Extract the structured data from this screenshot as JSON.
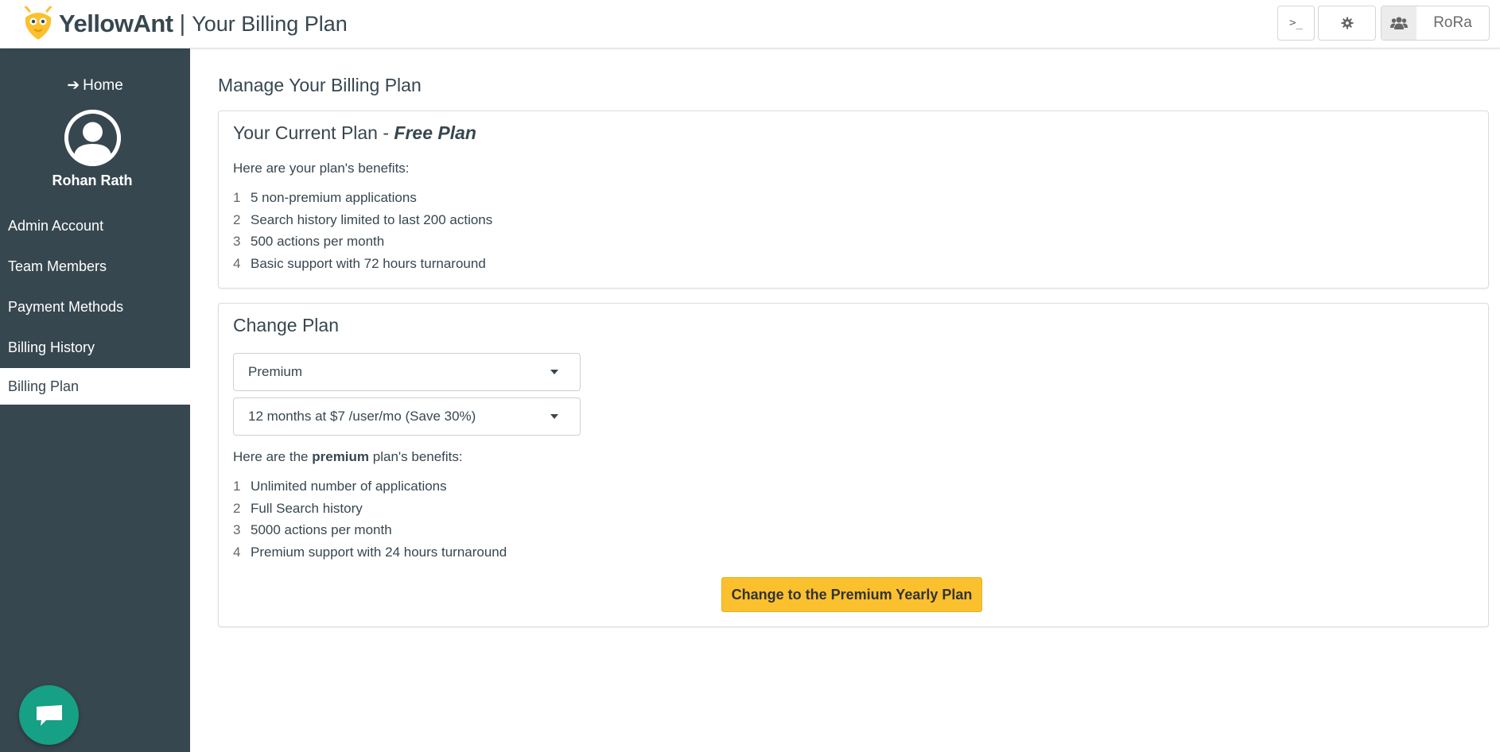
{
  "header": {
    "brand_name": "YellowAnt",
    "separator": "|",
    "page_title": "Your Billing Plan",
    "terminal_label": ">_",
    "user_label": "RoRa"
  },
  "sidebar": {
    "home_label": "Home",
    "user_name": "Rohan Rath",
    "items": [
      {
        "label": "Admin Account"
      },
      {
        "label": "Team Members"
      },
      {
        "label": "Payment Methods"
      },
      {
        "label": "Billing History"
      },
      {
        "label": "Billing Plan",
        "active": true
      }
    ]
  },
  "main": {
    "title": "Manage Your Billing Plan",
    "current_plan": {
      "title_prefix": "Your Current Plan - ",
      "plan_name": "Free Plan",
      "intro": "Here are your plan's benefits:",
      "benefits": [
        {
          "num": "1",
          "text": "5 non-premium applications"
        },
        {
          "num": "2",
          "text": "Search history limited to last 200 actions"
        },
        {
          "num": "3",
          "text": "500 actions per month"
        },
        {
          "num": "4",
          "text": "Basic support with 72 hours turnaround"
        }
      ]
    },
    "change_plan": {
      "title": "Change Plan",
      "plan_select": "Premium",
      "period_select": "12 months at $7 /user/mo (Save 30%)",
      "intro_prefix": "Here are the ",
      "intro_bold": "premium",
      "intro_suffix": " plan's benefits:",
      "benefits": [
        {
          "num": "1",
          "text": "Unlimited number of applications"
        },
        {
          "num": "2",
          "text": "Full Search history"
        },
        {
          "num": "3",
          "text": "5000 actions per month"
        },
        {
          "num": "4",
          "text": "Premium support with 24 hours turnaround"
        }
      ],
      "cta_label": "Change to the Premium Yearly Plan"
    }
  },
  "colors": {
    "sidebar_bg": "#37474f",
    "accent_yellow": "#fbc02d",
    "chat_green": "#16a085",
    "text": "#37474f"
  },
  "icons": {
    "logo": "yellowant-logo-icon",
    "terminal": "terminal-icon",
    "settings": "gear-icon",
    "team": "users-icon",
    "home": "arrow-left-icon",
    "avatar": "user-avatar-icon",
    "chat": "chat-bubble-icon",
    "select_caret": "caret-down-icon"
  }
}
